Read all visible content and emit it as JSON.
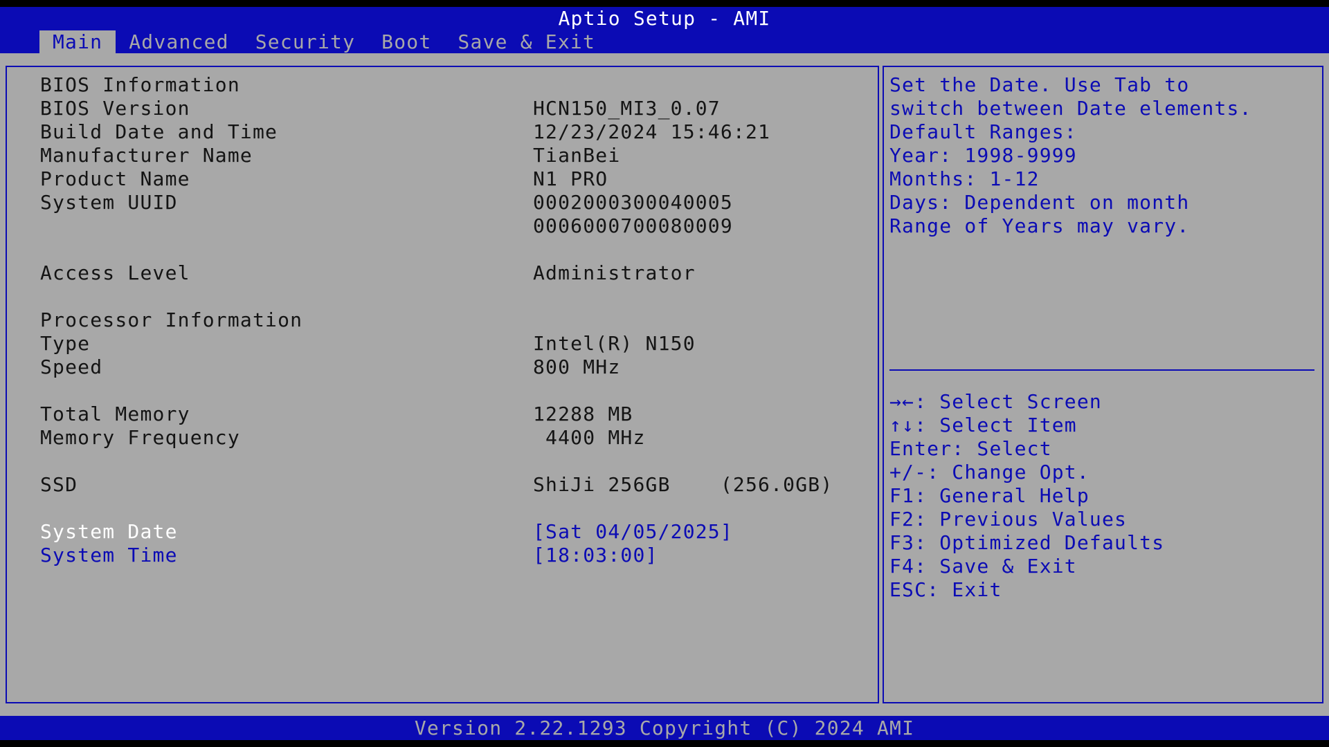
{
  "header": {
    "title": "Aptio Setup - AMI",
    "tabs": [
      {
        "label": "Main"
      },
      {
        "label": "Advanced"
      },
      {
        "label": "Security"
      },
      {
        "label": "Boot"
      },
      {
        "label": "Save & Exit"
      }
    ],
    "active_tab": "Main"
  },
  "main": {
    "bios_info_heading": "BIOS Information",
    "bios_version": {
      "label": "BIOS Version",
      "value": "HCN150_MI3_0.07"
    },
    "build_date": {
      "label": "Build Date and Time",
      "value": "12/23/2024 15:46:21"
    },
    "manufacturer": {
      "label": "Manufacturer Name",
      "value": "TianBei"
    },
    "product": {
      "label": "Product Name",
      "value": "N1 PRO"
    },
    "uuid": {
      "label": "System UUID",
      "value_line1": "0002000300040005",
      "value_line2": "0006000700080009"
    },
    "access_level": {
      "label": "Access Level",
      "value": "Administrator"
    },
    "processor_heading": "Processor Information",
    "proc_type": {
      "label": "Type",
      "value": "Intel(R) N150"
    },
    "proc_speed": {
      "label": "Speed",
      "value": "800 MHz"
    },
    "total_memory": {
      "label": "Total Memory",
      "value": "12288 MB"
    },
    "memory_frequency": {
      "label": "Memory Frequency",
      "value": " 4400 MHz"
    },
    "ssd": {
      "label": "SSD",
      "value": "ShiJi 256GB    (256.0GB)"
    },
    "system_date": {
      "label": "System Date",
      "value": "[Sat 04/05/2025]"
    },
    "system_time": {
      "label": "System Time",
      "value": "[18:03:00]"
    }
  },
  "help": {
    "lines": [
      "Set the Date. Use Tab to",
      "switch between Date elements.",
      "Default Ranges:",
      "Year: 1998-9999",
      "Months: 1-12",
      "Days: Dependent on month",
      "Range of Years may vary."
    ]
  },
  "keys": {
    "lines": [
      "→←: Select Screen",
      "↑↓: Select Item",
      "Enter: Select",
      "+/-: Change Opt.",
      "F1: General Help",
      "F2: Previous Values",
      "F3: Optimized Defaults",
      "F4: Save & Exit",
      "ESC: Exit"
    ]
  },
  "footer": {
    "version": "Version 2.22.1293 Copyright (C) 2024 AMI"
  },
  "colors": {
    "bios_blue": "#0b0bb4",
    "panel_gray": "#a8a8a8",
    "text_dark": "#141414",
    "selected_white": "#ffffff"
  }
}
